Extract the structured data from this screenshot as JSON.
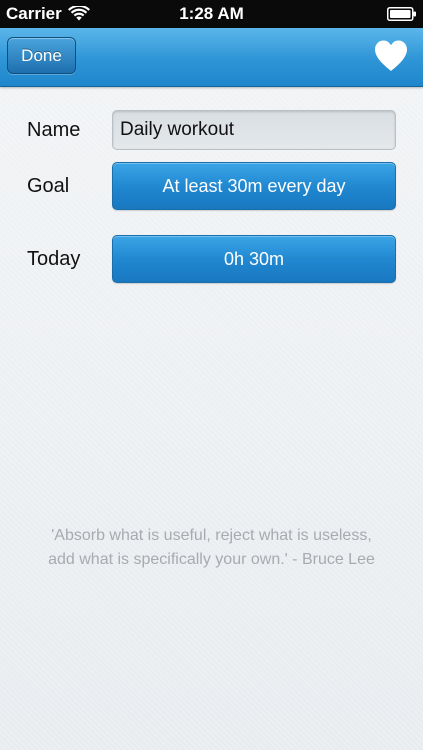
{
  "status_bar": {
    "carrier": "Carrier",
    "time": "1:28 AM"
  },
  "nav": {
    "done_label": "Done",
    "favorite_icon": "heart-icon"
  },
  "form": {
    "name": {
      "label": "Name",
      "value": "Daily workout"
    },
    "goal": {
      "label": "Goal",
      "value": "At least 30m every day"
    },
    "today": {
      "label": "Today",
      "value": "0h 30m"
    }
  },
  "quote": {
    "line1": "'Absorb what is useful, reject what is useless,",
    "line2": "add what is specifically your own.' - Bruce Lee"
  },
  "colors": {
    "nav_blue": "#2e95d6",
    "button_blue": "#1f86cf",
    "quote_gray": "#a7abb0"
  }
}
